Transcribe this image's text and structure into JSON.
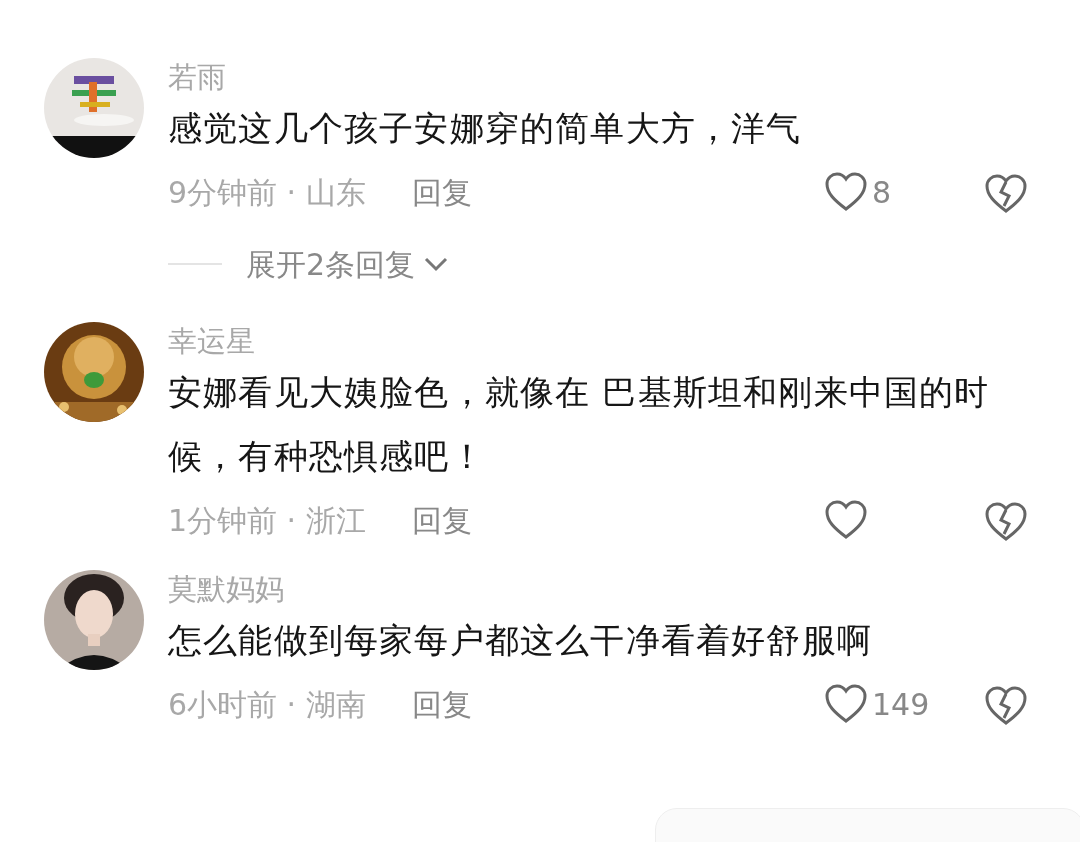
{
  "comments": [
    {
      "name": "若雨",
      "text": "感觉这几个孩子安娜穿的简单大方，洋气",
      "time": "9分钟前",
      "separator": "·",
      "location": "山东",
      "reply": "回复",
      "likes": "8",
      "expand": "展开2条回复"
    },
    {
      "name": "幸运星",
      "text": "安娜看见大姨脸色，就像在 巴基斯坦和刚来中国的时候，有种恐惧感吧！",
      "time": "1分钟前",
      "separator": "·",
      "location": "浙江",
      "reply": "回复"
    },
    {
      "name": "莫默妈妈",
      "text": "怎么能做到每家每户都这么干净看着好舒服啊",
      "time": "6小时前",
      "separator": "·",
      "location": "湖南",
      "reply": "回复",
      "likes": "149"
    }
  ]
}
